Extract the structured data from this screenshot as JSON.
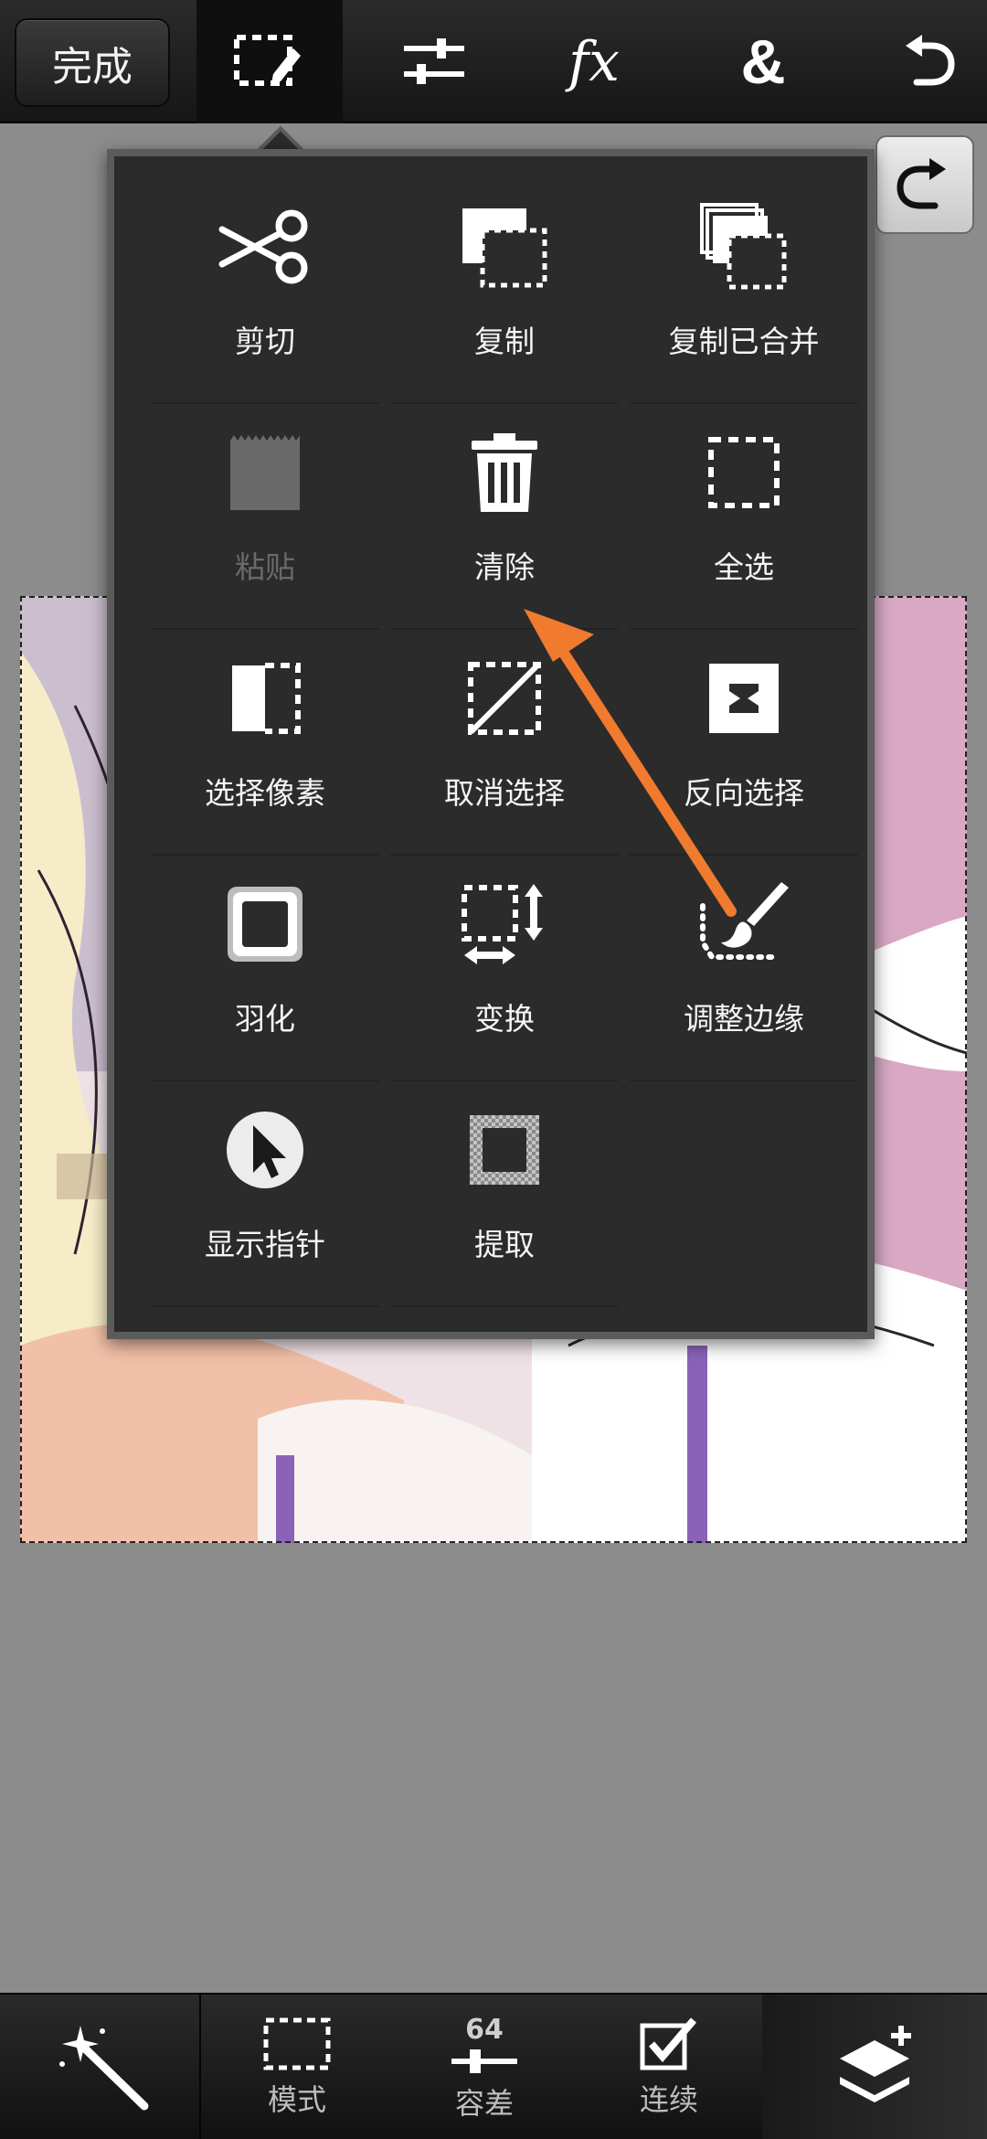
{
  "toolbar": {
    "done_label": "完成",
    "tools": [
      {
        "icon": "selection-edit-icon",
        "active": true
      },
      {
        "icon": "adjustments-icon",
        "active": false
      },
      {
        "icon": "fx-icon",
        "glyph": "fx",
        "active": false
      },
      {
        "icon": "ampersand-icon",
        "glyph": "&",
        "active": false
      },
      {
        "icon": "undo-icon",
        "active": false
      }
    ]
  },
  "side": {
    "redo_icon": "redo-icon"
  },
  "menu": {
    "items": [
      {
        "label": "剪切",
        "icon": "scissors-icon",
        "enabled": true
      },
      {
        "label": "复制",
        "icon": "copy-icon",
        "enabled": true
      },
      {
        "label": "复制已合并",
        "icon": "copy-merged-icon",
        "enabled": true
      },
      {
        "label": "粘贴",
        "icon": "paste-icon",
        "enabled": false
      },
      {
        "label": "清除",
        "icon": "trash-icon",
        "enabled": true
      },
      {
        "label": "全选",
        "icon": "select-all-icon",
        "enabled": true
      },
      {
        "label": "选择像素",
        "icon": "select-pixels-icon",
        "enabled": true
      },
      {
        "label": "取消选择",
        "icon": "deselect-icon",
        "enabled": true
      },
      {
        "label": "反向选择",
        "icon": "invert-selection-icon",
        "enabled": true
      },
      {
        "label": "羽化",
        "icon": "feather-icon",
        "enabled": true
      },
      {
        "label": "变换",
        "icon": "transform-icon",
        "enabled": true
      },
      {
        "label": "调整边缘",
        "icon": "refine-edge-icon",
        "enabled": true
      },
      {
        "label": "显示指针",
        "icon": "show-pointer-icon",
        "enabled": true
      },
      {
        "label": "提取",
        "icon": "extract-icon",
        "enabled": true
      }
    ]
  },
  "annotation": {
    "color": "#f07a2e",
    "points_to": "清除"
  },
  "bottombar": {
    "magic_wand_icon": "magic-wand-icon",
    "mode_label": "模式",
    "tolerance_value": "64",
    "tolerance_label": "容差",
    "contiguous_label": "连续",
    "layers_icon": "layers-add-icon"
  },
  "colors": {
    "toolbar_bg": "#1c1c1c",
    "menu_bg": "#2b2b2b",
    "menu_border": "#5b5b5b",
    "workspace_bg": "#8c8c8c",
    "arrow": "#f07a2e"
  }
}
